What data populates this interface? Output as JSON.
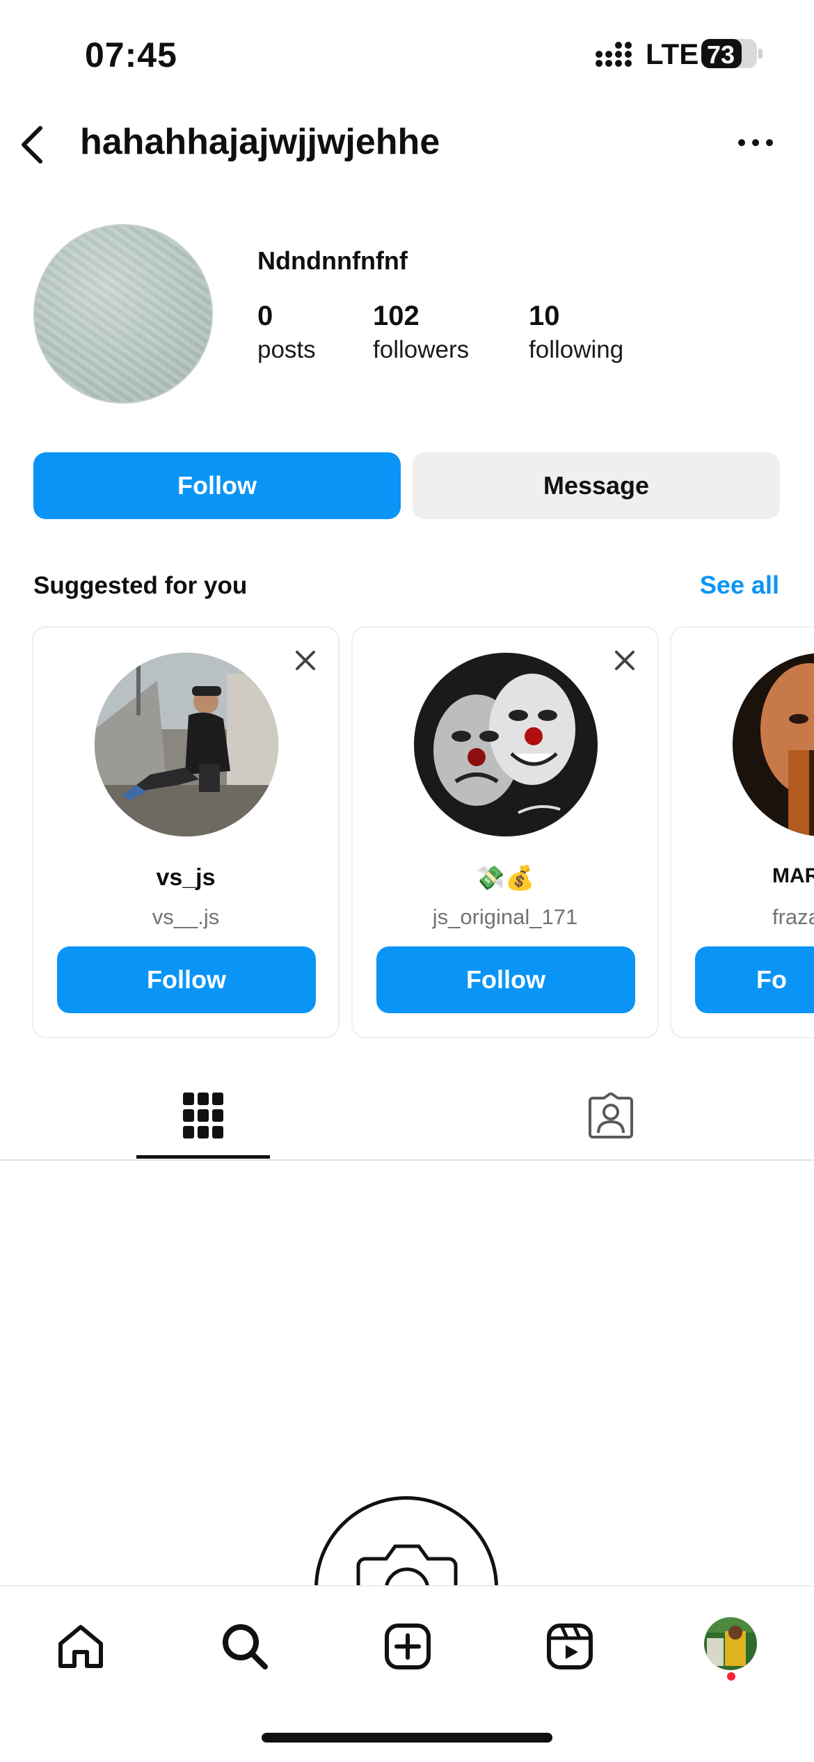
{
  "status_bar": {
    "time": "07:45",
    "network": "LTE",
    "battery": "73",
    "battery_level": 0.73
  },
  "header": {
    "username": "hahahhajajwjjwjehhe",
    "back_icon": "chevron-left-icon",
    "more_icon": "more-horizontal-icon"
  },
  "profile": {
    "display_name": "Ndndnnfnfnf",
    "stats": {
      "posts": {
        "value": "0",
        "label": "posts"
      },
      "followers": {
        "value": "102",
        "label": "followers"
      },
      "following": {
        "value": "10",
        "label": "following"
      }
    }
  },
  "actions": {
    "follow_label": "Follow",
    "message_label": "Message"
  },
  "suggested": {
    "title": "Suggested for you",
    "see_all_label": "See all",
    "cards": [
      {
        "name": "vs_js",
        "handle": "vs__.js",
        "follow_label": "Follow"
      },
      {
        "name": "💸💰",
        "handle": "js_original_171",
        "follow_label": "Follow"
      },
      {
        "name": "MAR",
        "handle": "fraza",
        "follow_label": "Fo"
      }
    ]
  },
  "tabs": [
    {
      "name": "posts-grid",
      "icon": "grid-icon",
      "active": true
    },
    {
      "name": "tagged",
      "icon": "tagged-person-icon",
      "active": false
    }
  ],
  "bottom_nav": {
    "items": [
      "home-icon",
      "search-icon",
      "create-icon",
      "reels-icon",
      "profile-avatar"
    ],
    "active": "search-icon"
  },
  "colors": {
    "accent": "#0a95f6",
    "secondary_button": "#efefef",
    "notification_dot": "#ff1f3d"
  }
}
